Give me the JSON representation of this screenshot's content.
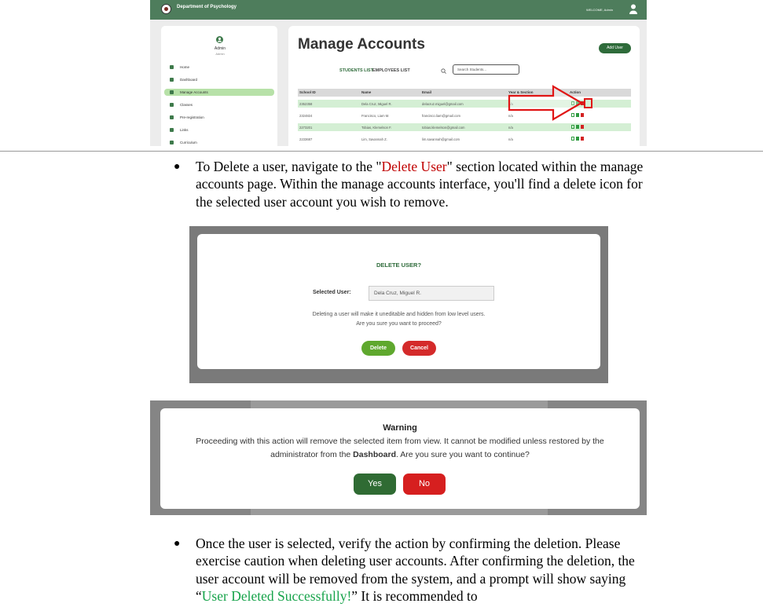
{
  "shot1": {
    "department": "Department of Psychology",
    "welcome": "WELCOME, Admin",
    "admin_name": "Admin",
    "admin_role": "Admin",
    "sidebar": [
      "Home",
      "Dashboard",
      "Manage Accounts",
      "Classes",
      "Pre-registration",
      "Links",
      "Curriculum"
    ],
    "page_title": "Manage Accounts",
    "add_user": "Add User",
    "tabs": [
      "STUDENTS LIST",
      "EMPLOYEES LIST"
    ],
    "search_placeholder": "Search Students...",
    "columns": [
      "School ID",
      "Name",
      "Email",
      "Year & Section",
      "Action"
    ],
    "rows": [
      [
        "2352358",
        "Dela Cruz, Miguel R.",
        "delacruz.miguel@gmail.com",
        "n/a"
      ],
      [
        "2324824",
        "Francisco, Liam M.",
        "francisco.liam@gmail.com",
        "n/a"
      ],
      [
        "2273201",
        "Tobias, Klemelson F.",
        "tobias.klemelson@gmail.com",
        "n/a"
      ],
      [
        "2233687",
        "Lim, Savannah Z.",
        "lim.savannah@gmail.com",
        "n/a"
      ]
    ],
    "colors": {
      "header": "#4e7d5c",
      "accent": "#2e6b3a",
      "delete": "#d32222"
    }
  },
  "para1": {
    "before": "To Delete a user, navigate to the \"",
    "highlight": "Delete User",
    "after": "\" section located within the manage accounts page. Within the manage accounts interface, you'll find a delete icon for the selected user account you wish to remove."
  },
  "shot2": {
    "title": "DELETE USER?",
    "selected_label": "Selected User:",
    "selected_value": "Dela Cruz, Miguel R.",
    "message_1": "Deleting a user will make it uneditable and hidden from low level users.",
    "message_2": "Are you sure you want to proceed?",
    "delete_label": "Delete",
    "cancel_label": "Cancel"
  },
  "shot3": {
    "title": "Warning",
    "line1": "Proceeding with this action will remove the selected item from view. It cannot be modified unless restored by the",
    "line2_before": "administrator from the ",
    "line2_bold": "Dashboard",
    "line2_after": ". Are you sure you want to continue?",
    "yes_label": "Yes",
    "no_label": "No"
  },
  "para2": {
    "before": "Once the user is selected, verify the action by confirming the deletion. Please exercise caution when deleting user accounts. After confirming the deletion, the user account will be removed from the system, and a prompt will show saying “",
    "highlight": "User Deleted Successfully!",
    "after": "” It is recommended to"
  }
}
